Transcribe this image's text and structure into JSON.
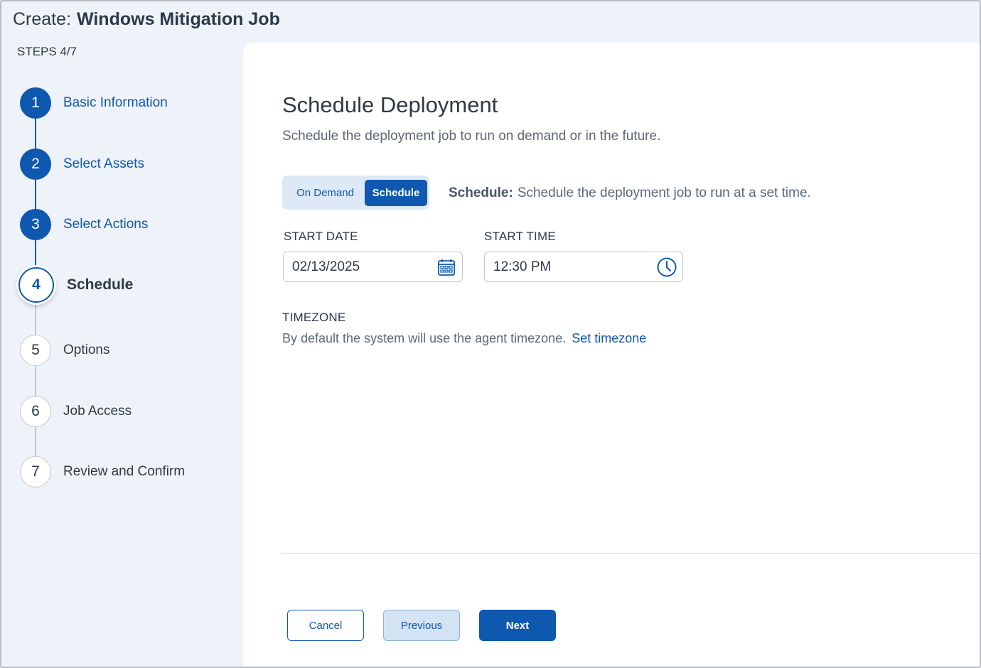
{
  "header": {
    "prefix": "Create:",
    "job_title": "Windows Mitigation Job"
  },
  "steps_count": "STEPS 4/7",
  "steps": [
    {
      "number": "1",
      "label": "Basic Information",
      "state": "done"
    },
    {
      "number": "2",
      "label": "Select Assets",
      "state": "done"
    },
    {
      "number": "3",
      "label": "Select Actions",
      "state": "done"
    },
    {
      "number": "4",
      "label": "Schedule",
      "state": "active"
    },
    {
      "number": "5",
      "label": "Options",
      "state": "todo"
    },
    {
      "number": "6",
      "label": "Job Access",
      "state": "todo"
    },
    {
      "number": "7",
      "label": "Review and Confirm",
      "state": "todo"
    }
  ],
  "main": {
    "heading": "Schedule Deployment",
    "subheading": "Schedule the deployment job to run on demand or in the future.",
    "toggle": {
      "on_demand_label": "On Demand",
      "schedule_label": "Schedule",
      "selected": "Schedule"
    },
    "mode_description": {
      "bold": "Schedule:",
      "text": "Schedule the deployment job to run at a set time."
    },
    "start_date": {
      "label": "START DATE",
      "value": "02/13/2025",
      "icon": "calendar-icon"
    },
    "start_time": {
      "label": "START TIME",
      "value": "12:30 PM",
      "icon": "clock-icon"
    },
    "timezone": {
      "label": "TIMEZONE",
      "text": "By default the system will use the agent timezone.",
      "link": "Set timezone"
    }
  },
  "footer": {
    "cancel_label": "Cancel",
    "previous_label": "Previous",
    "next_label": "Next"
  },
  "colors": {
    "accent": "#0f58b0",
    "sidebar_bg": "#eef3f9",
    "panel_bg": "#ffffff",
    "toggle_bg": "#dde9f6"
  }
}
